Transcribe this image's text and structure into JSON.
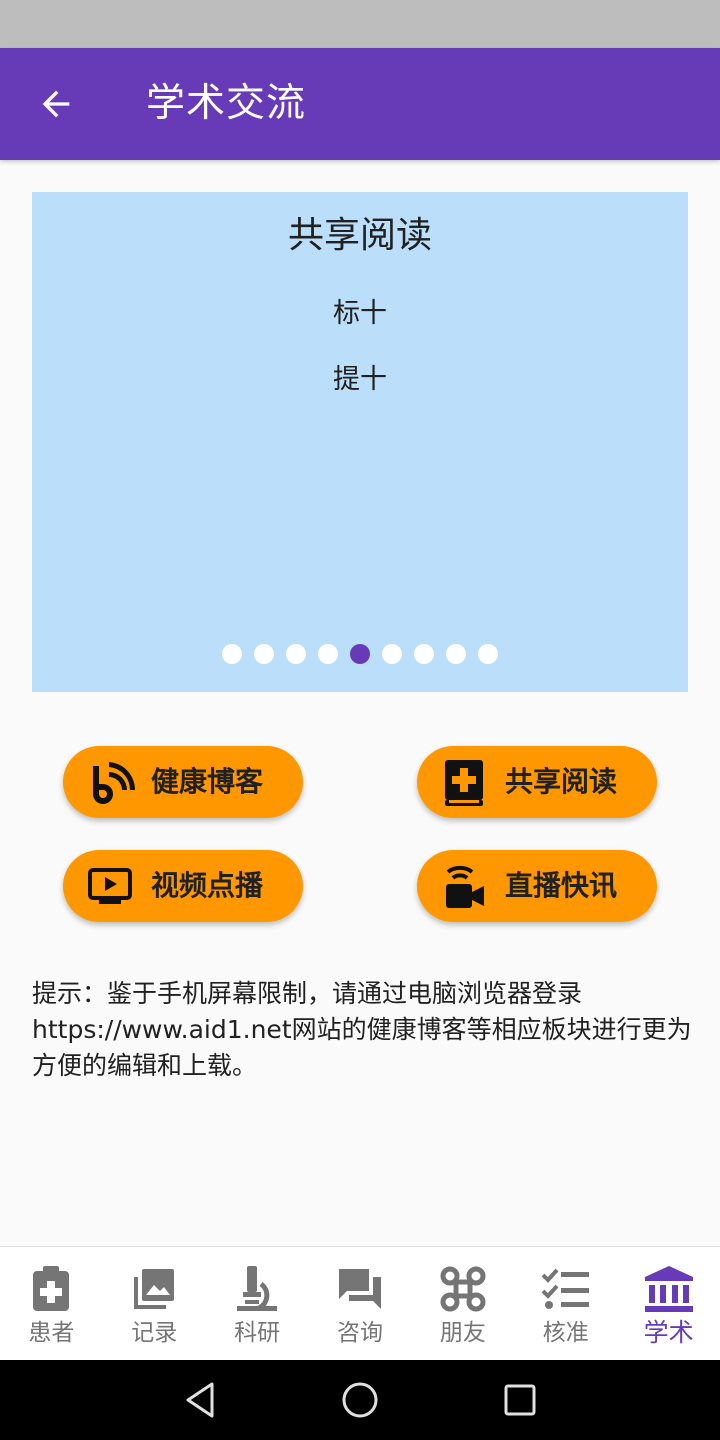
{
  "app_bar": {
    "title": "学术交流",
    "back_icon": "arrow-left-icon"
  },
  "carousel": {
    "title": "共享阅读",
    "line1": "标十",
    "line2": "提十",
    "dot_count": 9,
    "active_index": 4
  },
  "buttons": [
    {
      "label": "健康博客",
      "icon": "rss-blog-icon"
    },
    {
      "label": "共享阅读",
      "icon": "medical-book-icon"
    },
    {
      "label": "视频点播",
      "icon": "video-play-icon"
    },
    {
      "label": "直播快讯",
      "icon": "live-camera-icon"
    }
  ],
  "notice": "提示：鉴于手机屏幕限制，请通过电脑浏览器登录https://www.aid1.net网站的健康博客等相应板块进行更为方便的编辑和上载。",
  "bottom_nav": [
    {
      "label": "患者",
      "icon": "clipboard-plus-icon",
      "active": false
    },
    {
      "label": "记录",
      "icon": "photo-library-icon",
      "active": false
    },
    {
      "label": "科研",
      "icon": "microscope-icon",
      "active": false
    },
    {
      "label": "咨询",
      "icon": "chat-bubbles-icon",
      "active": false
    },
    {
      "label": "朋友",
      "icon": "command-icon",
      "active": false
    },
    {
      "label": "核准",
      "icon": "checklist-icon",
      "active": false
    },
    {
      "label": "学术",
      "icon": "institution-icon",
      "active": true
    }
  ],
  "colors": {
    "primary": "#673ab7",
    "accent": "#ff9800",
    "carousel_bg": "#bbdefb",
    "status_bar": "#bdbdbd"
  }
}
